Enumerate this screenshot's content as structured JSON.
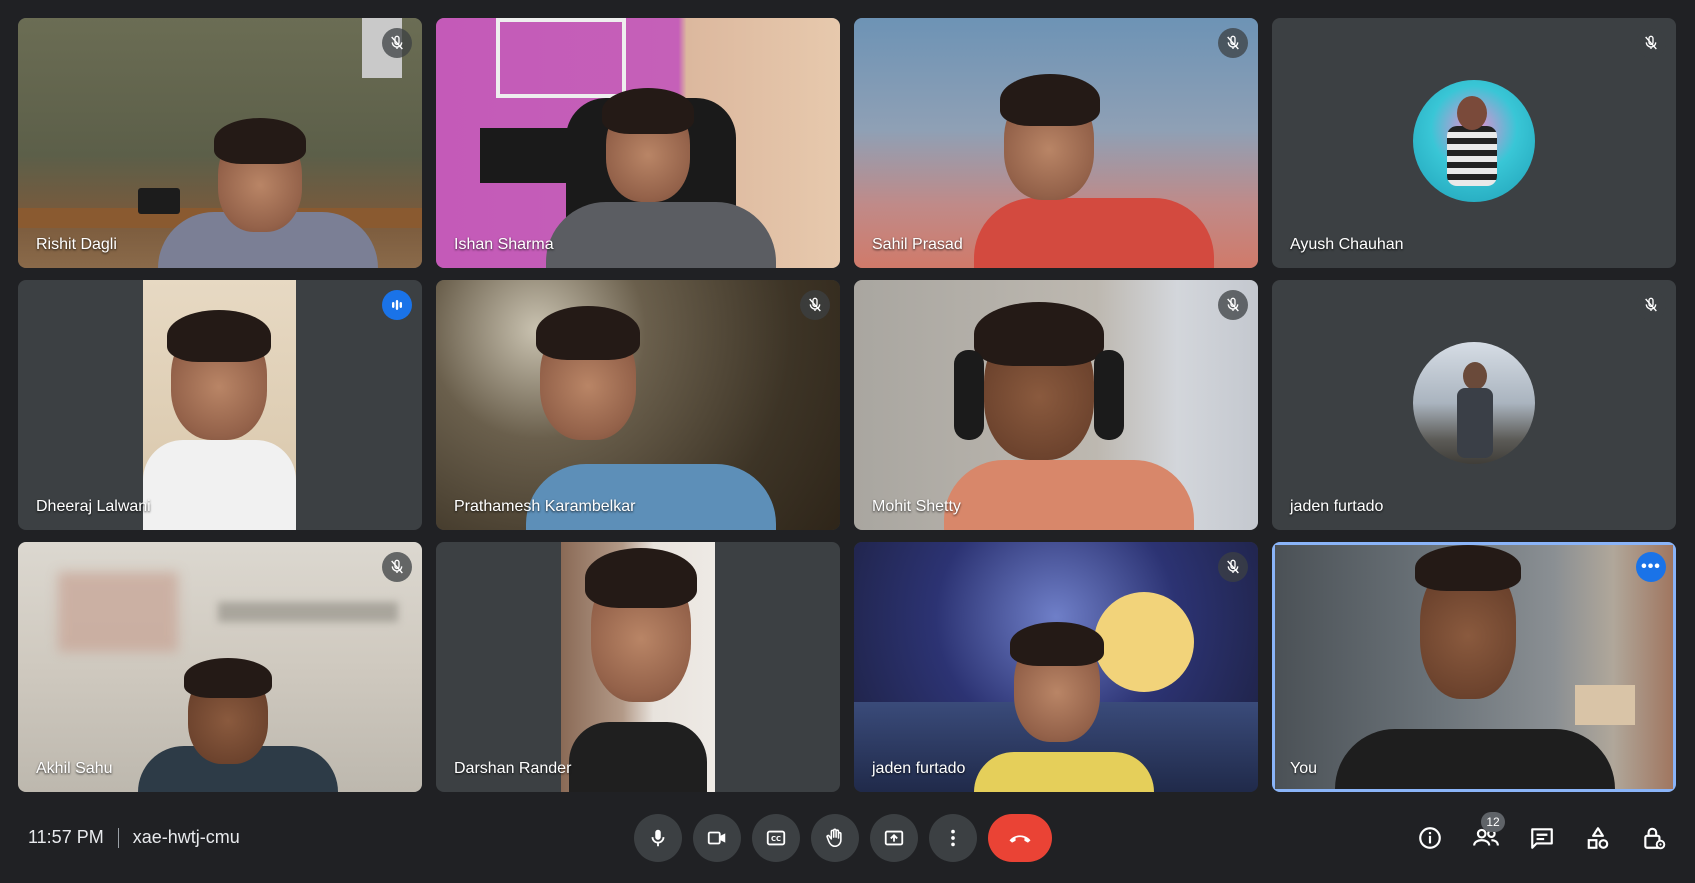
{
  "participants": [
    {
      "name": "Rishit Dagli",
      "muted": true
    },
    {
      "name": "Ishan Sharma",
      "muted": false
    },
    {
      "name": "Sahil Prasad",
      "muted": true
    },
    {
      "name": "Ayush Chauhan",
      "muted": true
    },
    {
      "name": "Dheeraj Lalwani",
      "speaking": true
    },
    {
      "name": "Prathamesh Karambelkar",
      "muted": true
    },
    {
      "name": "Mohit Shetty",
      "muted": true
    },
    {
      "name": "jaden furtado",
      "muted": true
    },
    {
      "name": "Akhil Sahu",
      "muted": true
    },
    {
      "name": "Darshan Rander",
      "muted": false
    },
    {
      "name": "jaden furtado",
      "muted": true
    },
    {
      "name": "You",
      "self": true
    }
  ],
  "meeting": {
    "time": "11:57 PM",
    "code": "xae-hwtj-cmu"
  },
  "controls": {
    "items": [
      "microphone-icon",
      "camera-icon",
      "captions-icon",
      "raise-hand-icon",
      "present-icon",
      "more-options-icon",
      "end-call-icon"
    ]
  },
  "right_actions": {
    "people_count": "12",
    "items": [
      "info-icon",
      "people-icon",
      "chat-icon",
      "activities-icon",
      "host-controls-icon"
    ]
  },
  "colors": {
    "background": "#202124",
    "tile": "#3c4043",
    "accent": "#1a73e8",
    "end_call": "#ea4335",
    "self_border": "#8ab4f8"
  }
}
